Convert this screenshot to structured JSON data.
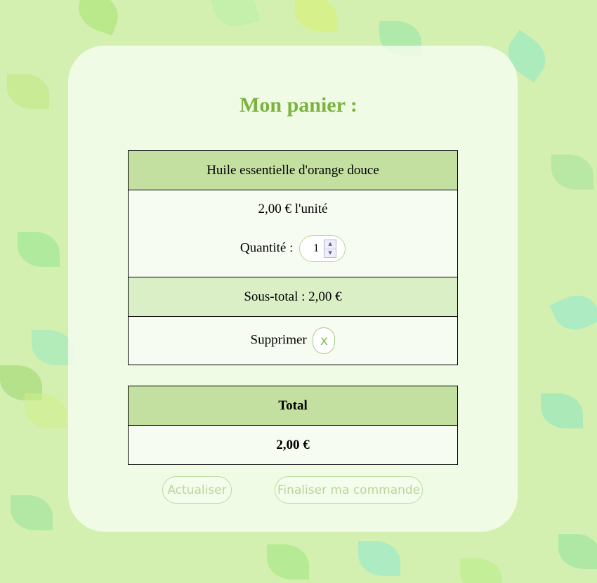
{
  "page": {
    "title": "Mon panier :",
    "colors": {
      "background": "#d3f0b0",
      "accent": "#7bb33f",
      "header_row": "#c3e0a0",
      "button_text": "#b6d79b"
    }
  },
  "cart": {
    "items": [
      {
        "name": "Huile essentielle d'orange douce",
        "unit_price": "2,00 € l'unité",
        "quantity_label": "Quantité :",
        "quantity": "1",
        "subtotal": "Sous-total : 2,00 €",
        "remove_label": "Supprimer",
        "remove_icon": "x"
      }
    ],
    "total_label": "Total",
    "total_value": "2,00 €"
  },
  "actions": {
    "refresh_label": "Actualiser",
    "checkout_label": "Finaliser ma commande"
  }
}
